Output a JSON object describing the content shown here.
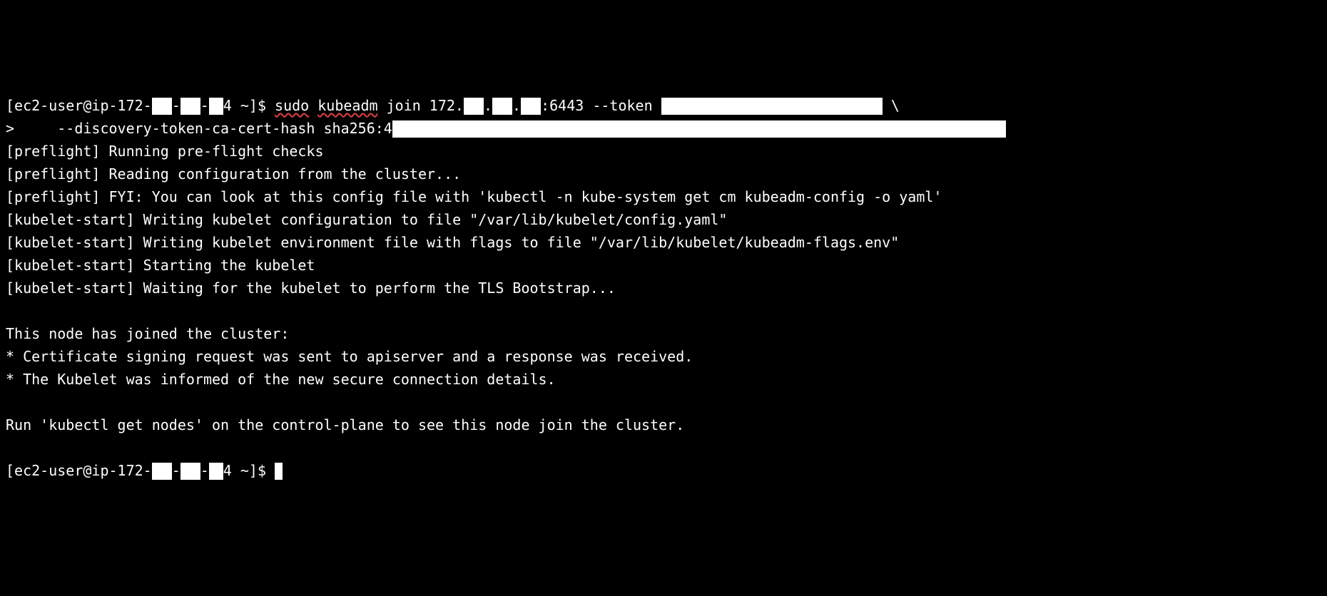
{
  "cmd1": {
    "prompt_prefix": "[ec2-user@ip-172-",
    "prompt_suffix": "4 ~]$ ",
    "sudo": "sudo",
    "space1": " ",
    "kubeadm": "kubeadm",
    "rest1": " join 172.",
    "dot1": ".",
    "dot2": ".",
    "rest2": ":6443 --token ",
    "backslash": " \\",
    "cont_prompt": ">     --discovery-token-ca-cert-hash sha256:4"
  },
  "output": {
    "l1": "[preflight] Running pre-flight checks",
    "l2": "[preflight] Reading configuration from the cluster...",
    "l3": "[preflight] FYI: You can look at this config file with 'kubectl -n kube-system get cm kubeadm-config -o yaml'",
    "l4": "[kubelet-start] Writing kubelet configuration to file \"/var/lib/kubelet/config.yaml\"",
    "l5": "[kubelet-start] Writing kubelet environment file with flags to file \"/var/lib/kubelet/kubeadm-flags.env\"",
    "l6": "[kubelet-start] Starting the kubelet",
    "l7": "[kubelet-start] Waiting for the kubelet to perform the TLS Bootstrap...",
    "blank1": " ",
    "l8": "This node has joined the cluster:",
    "l9": "* Certificate signing request was sent to apiserver and a response was received.",
    "l10": "* The Kubelet was informed of the new secure connection details.",
    "blank2": " ",
    "l11": "Run 'kubectl get nodes' on the control-plane to see this node join the cluster.",
    "blank3": " "
  },
  "cmd2": {
    "prompt_prefix": "[ec2-user@ip-172-",
    "prompt_suffix": "4 ~]$ "
  }
}
